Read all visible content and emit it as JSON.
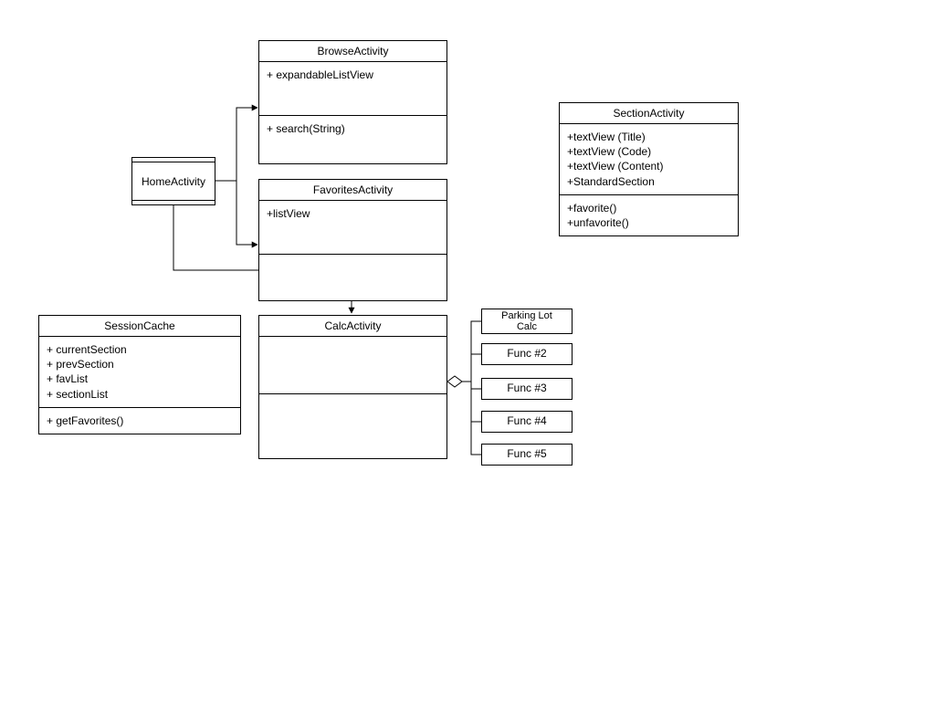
{
  "home": {
    "title": "HomeActivity"
  },
  "browse": {
    "title": "BrowseActivity",
    "attr1": "+ expandableListView",
    "method1": "+ search(String)"
  },
  "favorites": {
    "title": "FavoritesActivity",
    "attr1": "+listView"
  },
  "sessionCache": {
    "title": "SessionCache",
    "attr1": "+ currentSection",
    "attr2": "+ prevSection",
    "attr3": "+ favList",
    "attr4": "+ sectionList",
    "method1": "+ getFavorites()"
  },
  "calc": {
    "title": "CalcActivity"
  },
  "sectionActivity": {
    "title": "SectionActivity",
    "attr1": "+textView (Title)",
    "attr2": "+textView (Code)",
    "attr3": "+textView (Content)",
    "attr4": "+StandardSection",
    "method1": "+favorite()",
    "method2": "+unfavorite()"
  },
  "funcs": {
    "f1a": "Parking Lot",
    "f1b": "Calc",
    "f2": "Func #2",
    "f3": "Func #3",
    "f4": "Func #4",
    "f5": "Func #5"
  }
}
